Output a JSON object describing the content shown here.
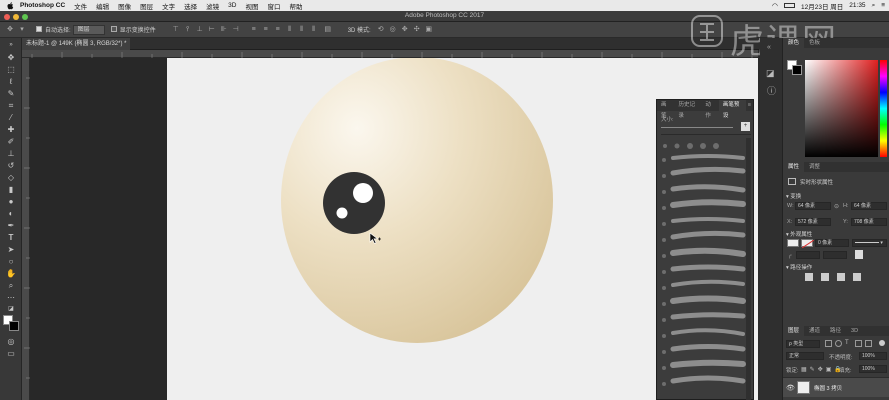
{
  "menubar": {
    "app_name": "Photoshop CC",
    "items": [
      "文件",
      "编辑",
      "图像",
      "图层",
      "文字",
      "选择",
      "滤镜",
      "3D",
      "视图",
      "窗口",
      "帮助"
    ],
    "date_time": "12月23日 周日",
    "time": "21:35"
  },
  "window": {
    "title": "Adobe Photoshop CC 2017",
    "doc_tab": "未标题-1 @ 149K (椭圆 3, RGB/32*) *"
  },
  "options_bar": {
    "auto_select_label": "自动选择:",
    "auto_select_value": "图层",
    "show_transform_label": "显示变换控件",
    "mode_3d_label": "3D 模式:"
  },
  "watermark": {
    "text": "虎课网"
  },
  "brush_panel": {
    "tabs": [
      "画笔",
      "历史记录",
      "动作",
      "画笔预设"
    ],
    "active_tab": 3,
    "size_label": "大小:"
  },
  "color_panel": {
    "tabs": [
      "颜色",
      "色板"
    ]
  },
  "properties_panel": {
    "tabs": [
      "属性",
      "调整"
    ],
    "title": "实时形状属性",
    "section_transform": "变换",
    "w_label": "W:",
    "w_value": "64 像素",
    "h_label": "H:",
    "h_value": "64 像素",
    "x_label": "X:",
    "x_value": "572 像素",
    "y_label": "Y:",
    "y_value": "708 像素",
    "section_appearance": "外观属性",
    "stroke_width": "0 像素",
    "section_path_ops": "路径操作"
  },
  "layers_panel": {
    "tabs": [
      "图层",
      "通道",
      "路径",
      "3D"
    ],
    "kind_filter": "ρ 类型",
    "blend_mode": "正常",
    "opacity_label": "不透明度:",
    "opacity_value": "100%",
    "lock_label": "锁定:",
    "fill_label": "填充:",
    "fill_value": "100%",
    "layer_name": "椭圆 3 拷贝"
  },
  "colors": {
    "ball_light": "#fbf7ee",
    "ball_mid": "#ede0c4",
    "ball_dark": "#d8c49a",
    "eye": "#323232",
    "fg_swatch": "#ffffff",
    "bg_swatch": "#000000"
  },
  "icons": [
    "apple-icon",
    "move-tool-icon",
    "marquee-tool-icon",
    "lasso-tool-icon",
    "brush-tool-icon",
    "type-tool-icon",
    "pen-tool-icon",
    "hand-tool-icon",
    "zoom-tool-icon",
    "move-cursor-icon",
    "eye-visibility-icon"
  ]
}
